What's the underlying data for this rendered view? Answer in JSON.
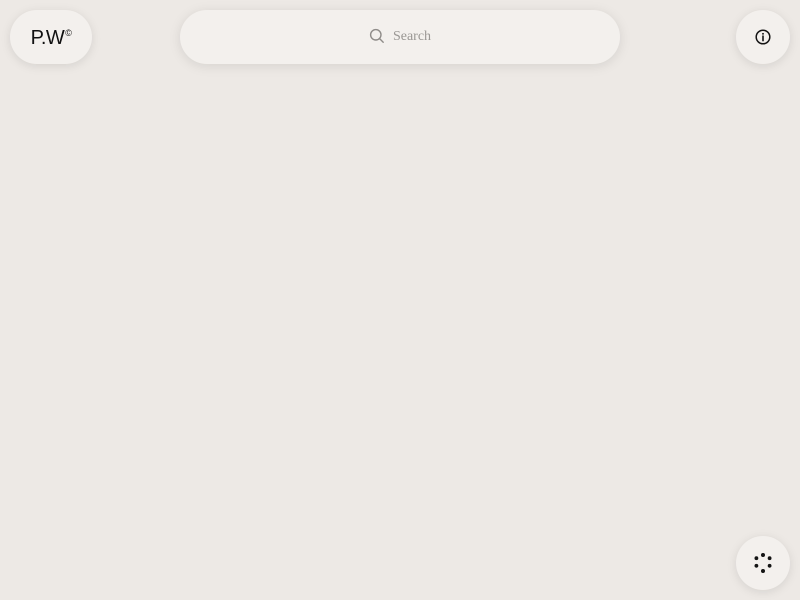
{
  "header": {
    "logo": {
      "text": "P.W",
      "mark": "©"
    },
    "search": {
      "placeholder": "Search",
      "icon": "search-icon"
    },
    "info_button": {
      "icon": "info-icon"
    }
  },
  "footer": {
    "loader_button": {
      "icon": "loader-dots-icon"
    }
  },
  "colors": {
    "background": "#ede9e5",
    "pill": "#f3f0ed",
    "ink": "#141414",
    "placeholder": "#9a9794"
  }
}
